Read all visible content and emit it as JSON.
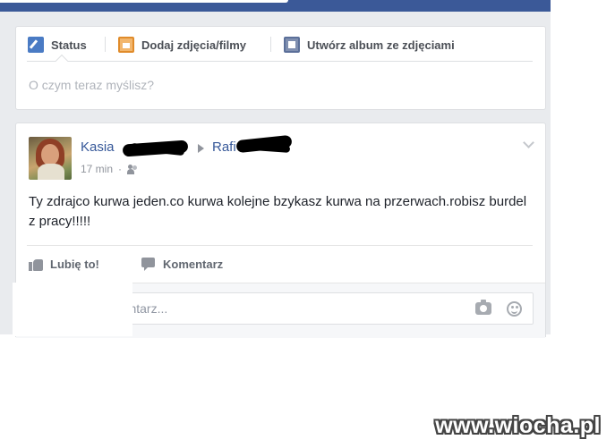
{
  "composer": {
    "tabs": [
      {
        "label": "Status",
        "icon": "pencil-icon"
      },
      {
        "label": "Dodaj zdjęcia/filmy",
        "icon": "photo-icon"
      },
      {
        "label": "Utwórz album ze zdjęciami",
        "icon": "album-icon"
      }
    ],
    "placeholder": "O czym teraz myślisz?"
  },
  "post": {
    "author": "Kasia",
    "target": "Rafi",
    "time": "17 min",
    "audience_icon": "friends-icon",
    "text": "Ty zdrajco kurwa jeden.co kurwa kolejne bzykasz kurwa na przerwach.robisz burdel z pracy!!!!!",
    "actions": {
      "like": "Lubię to!",
      "comment": "Komentarz"
    },
    "comment_placeholder": "mentarz..."
  },
  "watermark": "www.wiocha.pl",
  "colors": {
    "brand": "#3b5998",
    "link": "#365899",
    "background": "#e9ebee"
  }
}
